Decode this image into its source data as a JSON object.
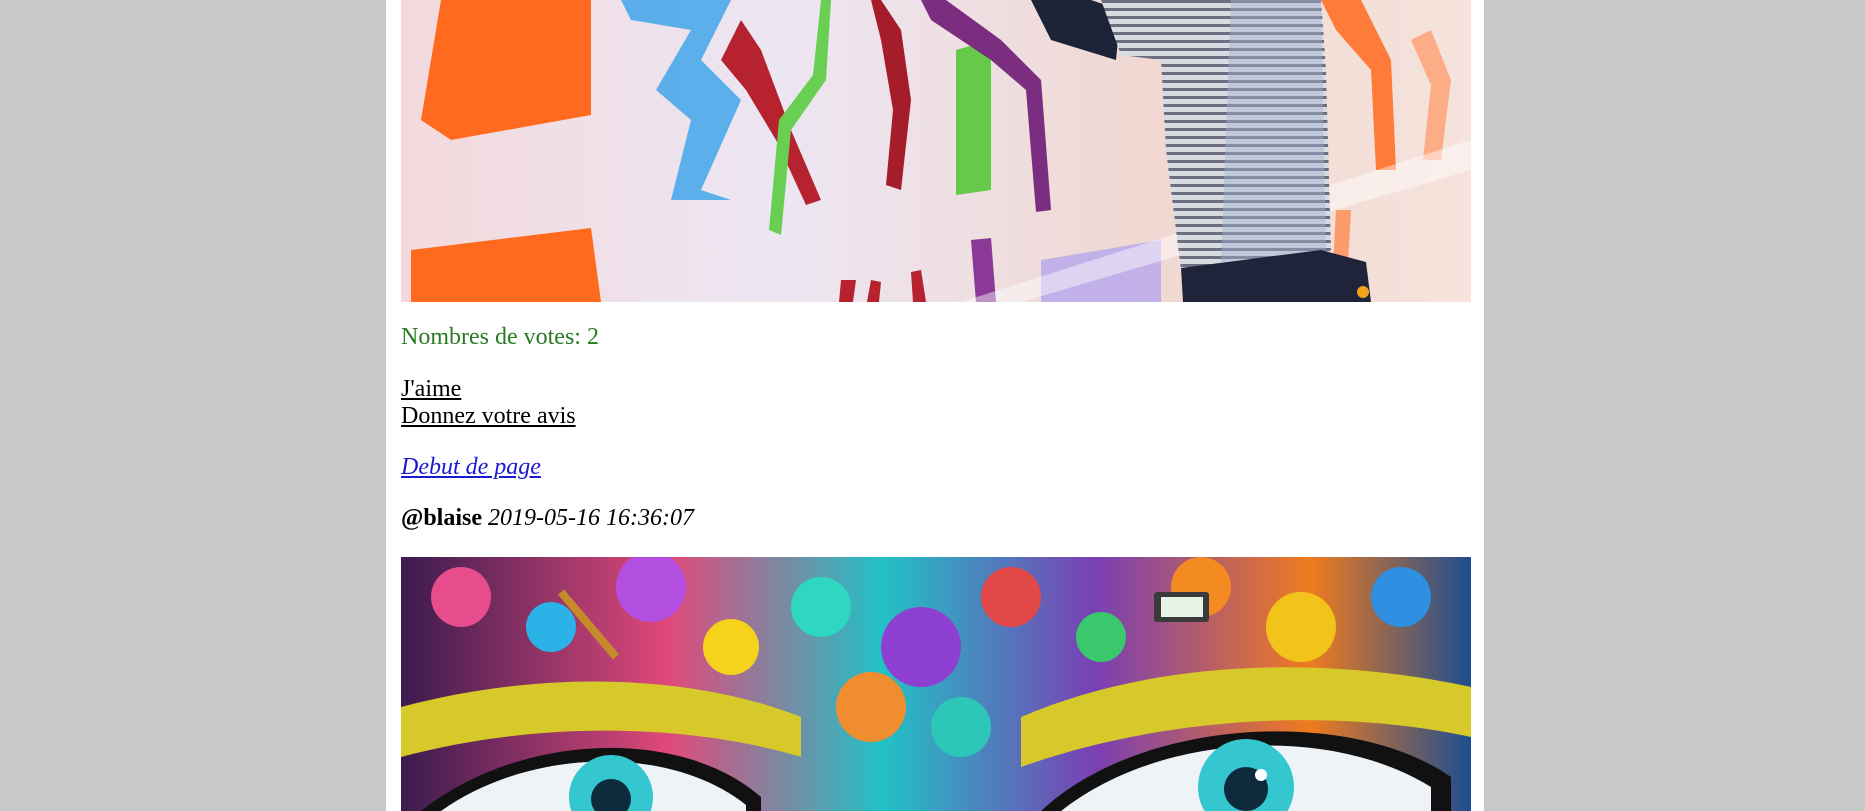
{
  "post_previous": {
    "image_alt": "Artist painting a colorful mural",
    "votes_label": "Nombres de votes: 2",
    "like_link": "J'aime",
    "review_link": "Donnez votre avis",
    "top_link": "Debut de page"
  },
  "post_next": {
    "author": "@blaise",
    "date": "2019-05-16 16:36:07",
    "image_alt": "Colorful graffiti mural of eyes"
  },
  "colors": {
    "background": "#c8c8c8",
    "page": "#ffffff",
    "votes_text": "#2a7a23",
    "top_link": "#1a1ad0"
  }
}
